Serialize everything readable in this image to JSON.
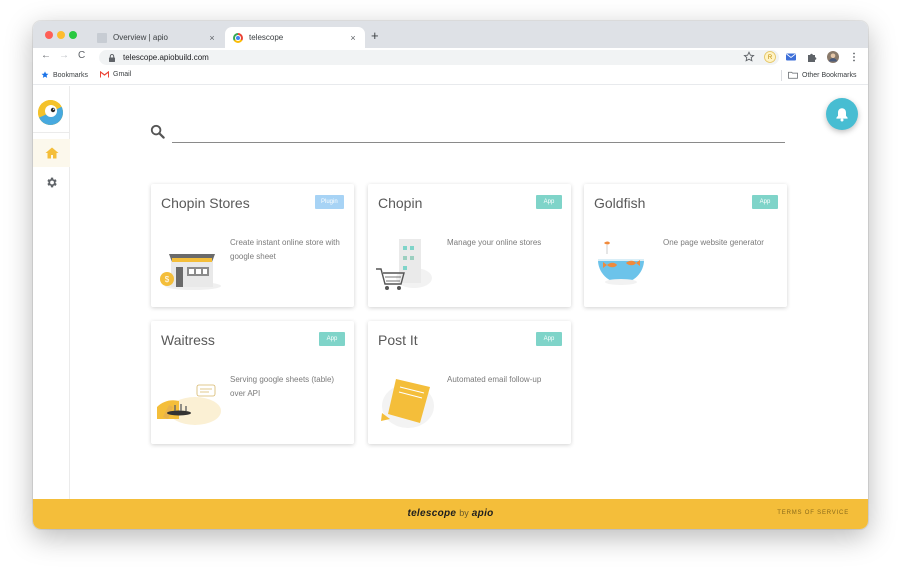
{
  "browser": {
    "tabs": [
      {
        "title": "Overview | apio",
        "close": "×",
        "active": false
      },
      {
        "title": "telescope",
        "close": "×",
        "active": true
      }
    ],
    "new_tab": "+",
    "nav": {
      "back": "←",
      "forward": "→",
      "reload": "C"
    },
    "url": "telescope.apiobuild.com",
    "bookmarks": [
      {
        "label": "Bookmarks",
        "icon": "star-icon"
      },
      {
        "label": "Gmail",
        "icon": "gmail-icon"
      }
    ],
    "other_bookmarks": "Other Bookmarks",
    "extensions": [
      "star-icon",
      "extension-r-icon",
      "extension-mail-icon",
      "puzzle-icon",
      "profile-avatar",
      "more-vert-icon"
    ]
  },
  "app": {
    "sidebar": [
      {
        "name": "home",
        "icon": "home-icon",
        "active": true
      },
      {
        "name": "settings",
        "icon": "gear-icon",
        "active": false
      }
    ],
    "search": {
      "placeholder": "",
      "value": ""
    },
    "cards": [
      {
        "title": "Chopin Stores",
        "badge": "Plugin",
        "badge_color": "#a7d3f5",
        "description": "Create instant online store with google sheet",
        "illustration": "storefront-illustration"
      },
      {
        "title": "Chopin",
        "badge": "App",
        "badge_color": "#7fd4c9",
        "description": "Manage your online stores",
        "illustration": "shopping-cart-illustration"
      },
      {
        "title": "Goldfish",
        "badge": "App",
        "badge_color": "#7fd4c9",
        "description": "One page website generator",
        "illustration": "goldfish-bowl-illustration"
      },
      {
        "title": "Waitress",
        "badge": "App",
        "badge_color": "#7fd4c9",
        "description": "Serving google sheets (table) over API",
        "illustration": "waiter-tray-illustration"
      },
      {
        "title": "Post It",
        "badge": "App",
        "badge_color": "#7fd4c9",
        "description": "Automated email follow-up",
        "illustration": "sticky-note-illustration"
      }
    ],
    "footer": {
      "brand_name": "telescope",
      "by": "by",
      "company": "apio",
      "terms": "TERMS OF SERVICE"
    },
    "colors": {
      "accent": "#f4be3a",
      "fab": "#47bdd2"
    }
  }
}
